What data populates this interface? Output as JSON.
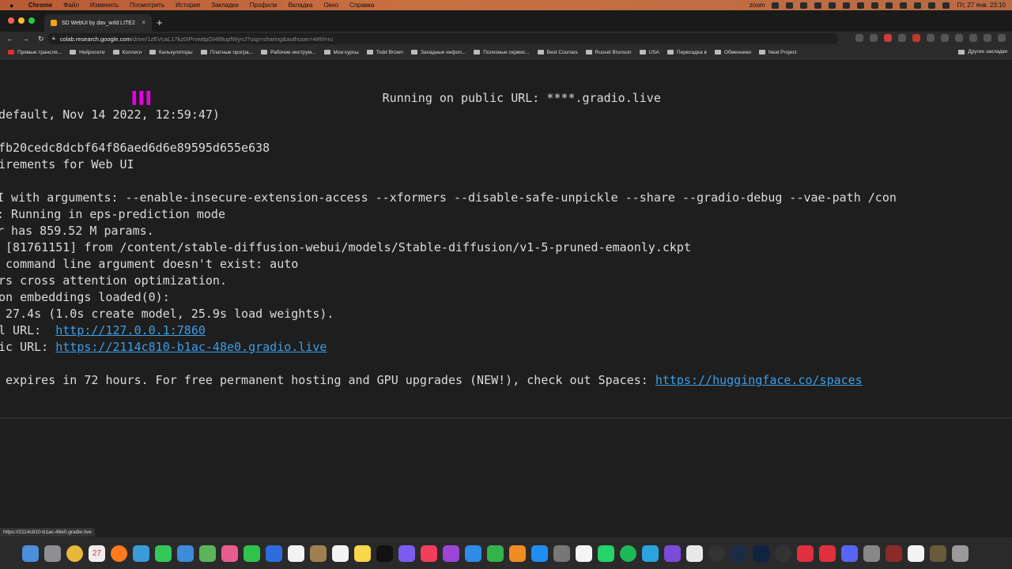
{
  "menubar": {
    "app": "Chrome",
    "items": [
      "Файл",
      "Изменить",
      "Посмотреть",
      "История",
      "Закладки",
      "Профили",
      "Вкладка",
      "Окно",
      "Справка"
    ],
    "status_items": [
      "zoom"
    ],
    "datetime": "Пт, 27 янв. 23:10"
  },
  "tab": {
    "title": "SD WebUI by dav_wrld LITE2",
    "close": "×",
    "new_tab": "+"
  },
  "address": {
    "host": "colab.research.google.com",
    "path": "/drive/1zEVcaL17kz0IPrvwttpGt4ll9upfWynJ?usp=sharing&authuser=4#hl=ru"
  },
  "bookmarks": [
    {
      "label": "Прямые трансля...",
      "icon": "youtube-icon"
    },
    {
      "label": "Нейросети",
      "icon": "folder-icon"
    },
    {
      "label": "Коллеги",
      "icon": "folder-icon"
    },
    {
      "label": "Калькуляторы",
      "icon": "folder-icon"
    },
    {
      "label": "Платные програ...",
      "icon": "folder-icon"
    },
    {
      "label": "Рабочие инструм...",
      "icon": "folder-icon"
    },
    {
      "label": "Мои курсы",
      "icon": "folder-icon"
    },
    {
      "label": "Todd Brown",
      "icon": "folder-icon"
    },
    {
      "label": "Западные инфоп...",
      "icon": "folder-icon"
    },
    {
      "label": "Полезные сервис...",
      "icon": "folder-icon"
    },
    {
      "label": "Best Courses",
      "icon": "folder-icon"
    },
    {
      "label": "Russel Brunson",
      "icon": "folder-icon"
    },
    {
      "label": "USA",
      "icon": "folder-icon"
    },
    {
      "label": "Пересадка в",
      "icon": "folder-icon"
    },
    {
      "label": "Обменники",
      "icon": "folder-icon"
    },
    {
      "label": "Neal Project",
      "icon": "folder-icon"
    }
  ],
  "bookmarks_other": "Другие закладки",
  "output": {
    "line1_magenta": "                  ",
    "line1_bar": "▌▌▌",
    "line1_text": "Running on public URL: ****.gradio.live",
    "line2": "default, Nov 14 2022, 12:59:47)",
    "line3": "fb20cedc8dcbf64f86aed6d6e89595d655e638",
    "line4": "irements for Web UI",
    "line5": "I with arguments: --enable-insecure-extension-access --xformers --disable-safe-unpickle --share --gradio-debug --vae-path /con",
    "line6": ": Running in eps-prediction mode",
    "line7": "r has 859.52 M params.",
    "line8": " [81761151] from /content/stable-diffusion-webui/models/Stable-diffusion/v1-5-pruned-emaonly.ckpt",
    "line9": " command line argument doesn't exist: auto",
    "line10": "rs cross attention optimization.",
    "line11": "on embeddings loaded(0):",
    "line12": " 27.4s (1.0s create model, 25.9s load weights).",
    "local_prefix": "l URL:  ",
    "local_url": "http://127.0.0.1:7860",
    "public_prefix": "ic URL: ",
    "public_url": "https://2114c810-b1ac-48e0.gradio.live",
    "expires_text": " expires in 72 hours. For free permanent hosting and GPU upgrades (NEW!), check out Spaces: ",
    "spaces_url": "https://huggingface.co/spaces"
  },
  "status_tooltip": "https://2114c810-b1ac-48e0.gradio.live",
  "dock": {
    "calendar_day": "27"
  }
}
